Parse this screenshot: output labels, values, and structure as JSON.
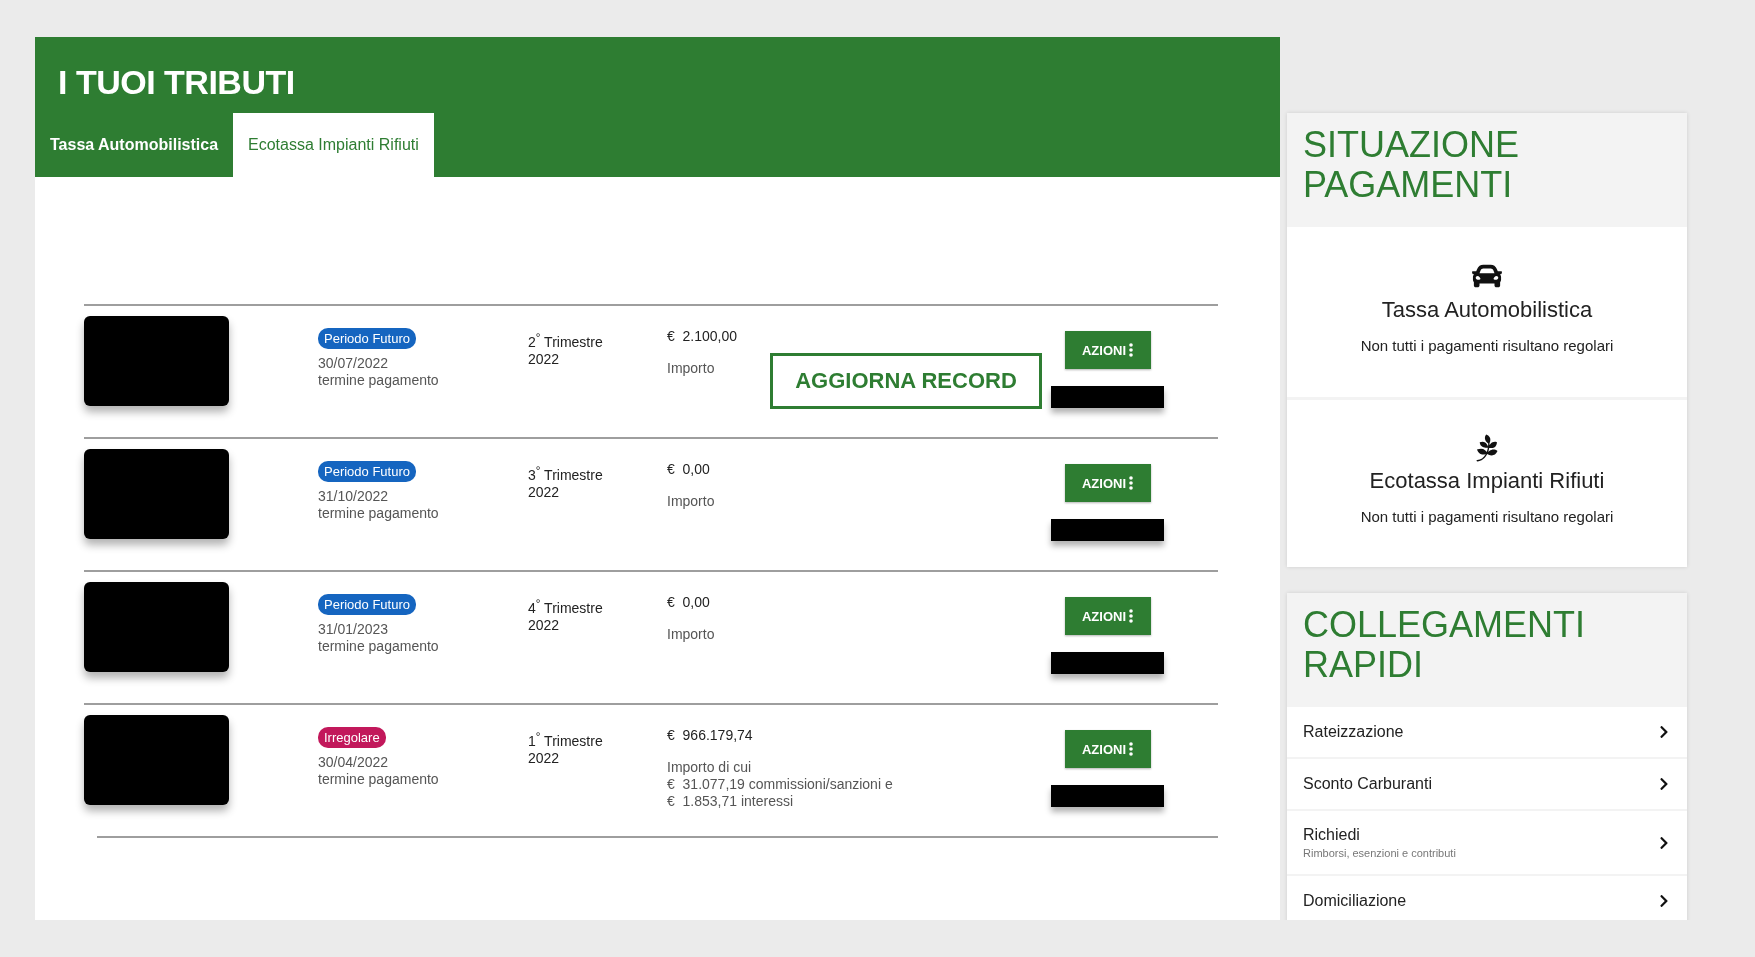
{
  "header": {
    "title": "I TUOI TRIBUTI"
  },
  "tabs": [
    {
      "label": "Tassa Automobilistica",
      "selected": false
    },
    {
      "label": "Ecotassa Impianti Rifiuti",
      "selected": true
    }
  ],
  "rows": [
    {
      "status": {
        "label": "Periodo Futuro",
        "color": "#1565c0"
      },
      "due_date": "30/07/2022",
      "due_label": "termine pagamento",
      "period": "2$^{°}$ Trimestre",
      "year": "2022",
      "amount": "€  2.100,00",
      "amount_details": [
        "Importo"
      ],
      "update_button": "AGGIORNA RECORD",
      "actions_button": "AZIONI"
    },
    {
      "status": {
        "label": "Periodo Futuro",
        "color": "#1565c0"
      },
      "due_date": "31/10/2022",
      "due_label": "termine pagamento",
      "period": "3$^{°}$ Trimestre",
      "year": "2022",
      "amount": "€  0,00",
      "amount_details": [
        "Importo"
      ],
      "actions_button": "AZIONI"
    },
    {
      "status": {
        "label": "Periodo Futuro",
        "color": "#1565c0"
      },
      "due_date": "31/01/2023",
      "due_label": "termine pagamento",
      "period": "4$^{°}$ Trimestre",
      "year": "2022",
      "amount": "€  0,00",
      "amount_details": [
        "Importo"
      ],
      "actions_button": "AZIONI"
    },
    {
      "status": {
        "label": "Irregolare",
        "color": "#c2185b"
      },
      "due_date": "30/04/2022",
      "due_label": "termine pagamento",
      "period": "1$^{°}$ Trimestre",
      "year": "2022",
      "amount": "€  966.179,74",
      "amount_details": [
        "Importo di cui",
        "€  31.077,19 commissioni/sanzioni e",
        "€  1.853,71 interessi"
      ],
      "actions_button": "AZIONI"
    }
  ],
  "payment_status": {
    "title": "SITUAZIONE PAGAMENTI",
    "items": [
      {
        "kind": "car",
        "title": "Tassa Automobilistica",
        "subtitle": "Non tutti i pagamenti risultano regolari"
      },
      {
        "kind": "plant",
        "title": "Ecotassa Impianti Rifiuti",
        "subtitle": "Non tutti i pagamenti risultano regolari"
      }
    ]
  },
  "quick_links": {
    "title": "COLLEGAMENTI RAPIDI",
    "items": [
      {
        "label": "Rateizzazione"
      },
      {
        "label": "Sconto Carburanti"
      },
      {
        "label": "Richiedi",
        "sublabel": "Rimborsi, esenzioni e contributi"
      },
      {
        "label": "Domiciliazione"
      }
    ]
  }
}
